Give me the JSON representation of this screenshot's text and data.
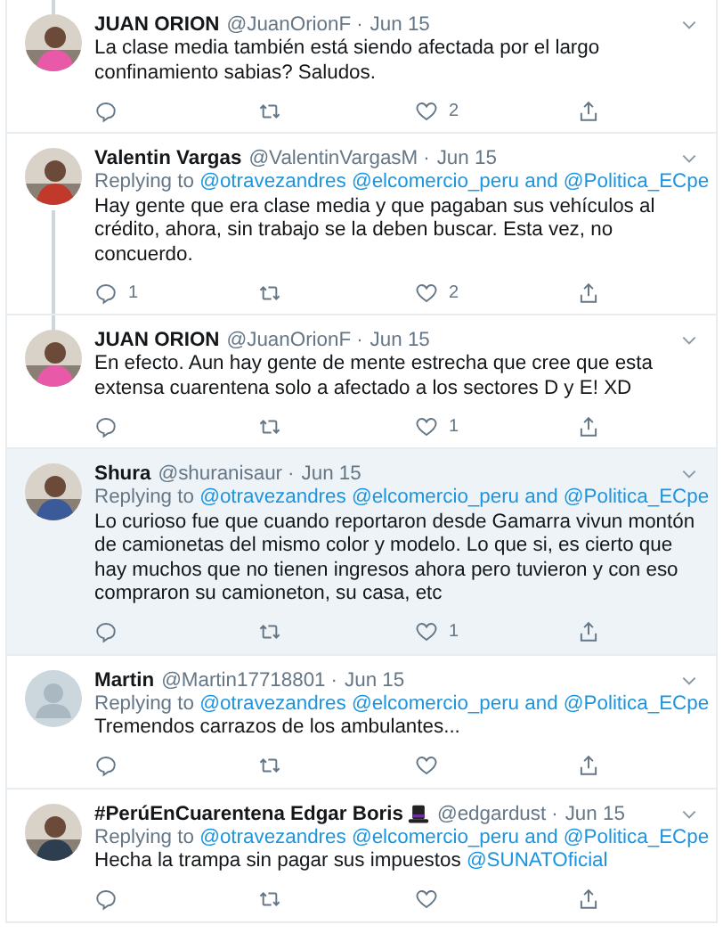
{
  "tweets": [
    {
      "name": "JUAN ORION",
      "hat_badge": false,
      "handle": "@JuanOrionF",
      "separator": "·",
      "date": "Jun 15",
      "avatar": {
        "kind": "picture",
        "color": "#e85aa8"
      },
      "thread_above": true,
      "thread_below": false,
      "highlighted": false,
      "body": [
        {
          "text": "La clase media también está siendo afectada por el largo confinamiento sabias? Saludos.",
          "link": false
        }
      ],
      "likes": "2"
    },
    {
      "name": "Valentin Vargas",
      "hat_badge": false,
      "handle": "@ValentinVargasM",
      "separator": "·",
      "date": "Jun 15",
      "avatar": {
        "kind": "picture",
        "color": "#c0392b"
      },
      "thread_above": false,
      "thread_below": true,
      "highlighted": false,
      "replying": {
        "label": "Replying to",
        "mentions": [
          "@otravezandres",
          "@elcomercio_peru"
        ],
        "conjunction": "and",
        "last": "@Politica_ECpe"
      },
      "body": [
        {
          "text": "Hay gente que era clase media y que pagaban sus vehículos al crédito, ahora, sin trabajo se la deben buscar. Esta vez, no concuerdo.",
          "link": false
        }
      ],
      "replies": "1",
      "likes": "2"
    },
    {
      "name": "JUAN ORION",
      "hat_badge": false,
      "handle": "@JuanOrionF",
      "separator": "·",
      "date": "Jun 15",
      "avatar": {
        "kind": "picture",
        "color": "#e85aa8"
      },
      "thread_above": true,
      "thread_below": false,
      "highlighted": false,
      "body": [
        {
          "text": "En efecto. Aun hay gente de mente estrecha que cree que esta extensa cuarentena solo a afectado a los sectores D y E! XD",
          "link": false
        }
      ],
      "likes": "1"
    },
    {
      "name": "Shura",
      "hat_badge": false,
      "handle": "@shuranisaur",
      "separator": "·",
      "date": "Jun 15",
      "avatar": {
        "kind": "picture",
        "color": "#3b5a9a"
      },
      "thread_above": false,
      "thread_below": false,
      "highlighted": true,
      "replying": {
        "label": "Replying to",
        "mentions": [
          "@otravezandres",
          "@elcomercio_peru"
        ],
        "conjunction": "and",
        "last": "@Politica_ECpe"
      },
      "body": [
        {
          "text": "Lo curioso fue que cuando reportaron desde Gamarra vivun montón de camionetas del mismo color y modelo. Lo que si, es cierto que hay muchos que no tienen ingresos ahora pero tuvieron y con eso compraron su camioneton, su casa, etc",
          "link": false
        }
      ],
      "likes": "1"
    },
    {
      "name": "Martin",
      "hat_badge": false,
      "handle": "@Martin17718801",
      "separator": "·",
      "date": "Jun 15",
      "avatar": {
        "kind": "default",
        "color": "#aab8c2"
      },
      "thread_above": false,
      "thread_below": false,
      "highlighted": false,
      "replying": {
        "label": "Replying to",
        "mentions": [
          "@otravezandres",
          "@elcomercio_peru"
        ],
        "conjunction": "and",
        "last": "@Politica_ECpe"
      },
      "body": [
        {
          "text": "Tremendos carrazos de los ambulantes...",
          "link": false
        }
      ]
    },
    {
      "name": "#PerúEnCuarentena Edgar Boris",
      "hat_badge": true,
      "handle": "@edgardust",
      "separator": "·",
      "date": "Jun 15",
      "avatar": {
        "kind": "picture",
        "color": "#2c3e50"
      },
      "thread_above": false,
      "thread_below": false,
      "highlighted": false,
      "replying": {
        "label": "Replying to",
        "mentions": [
          "@otravezandres",
          "@elcomercio_peru"
        ],
        "conjunction": "and",
        "last": "@Politica_ECpe"
      },
      "body": [
        {
          "text": "Hecha la trampa sin pagar sus impuestos",
          "link": false
        },
        {
          "text": "@SUNATOficial",
          "link": true
        }
      ]
    }
  ]
}
